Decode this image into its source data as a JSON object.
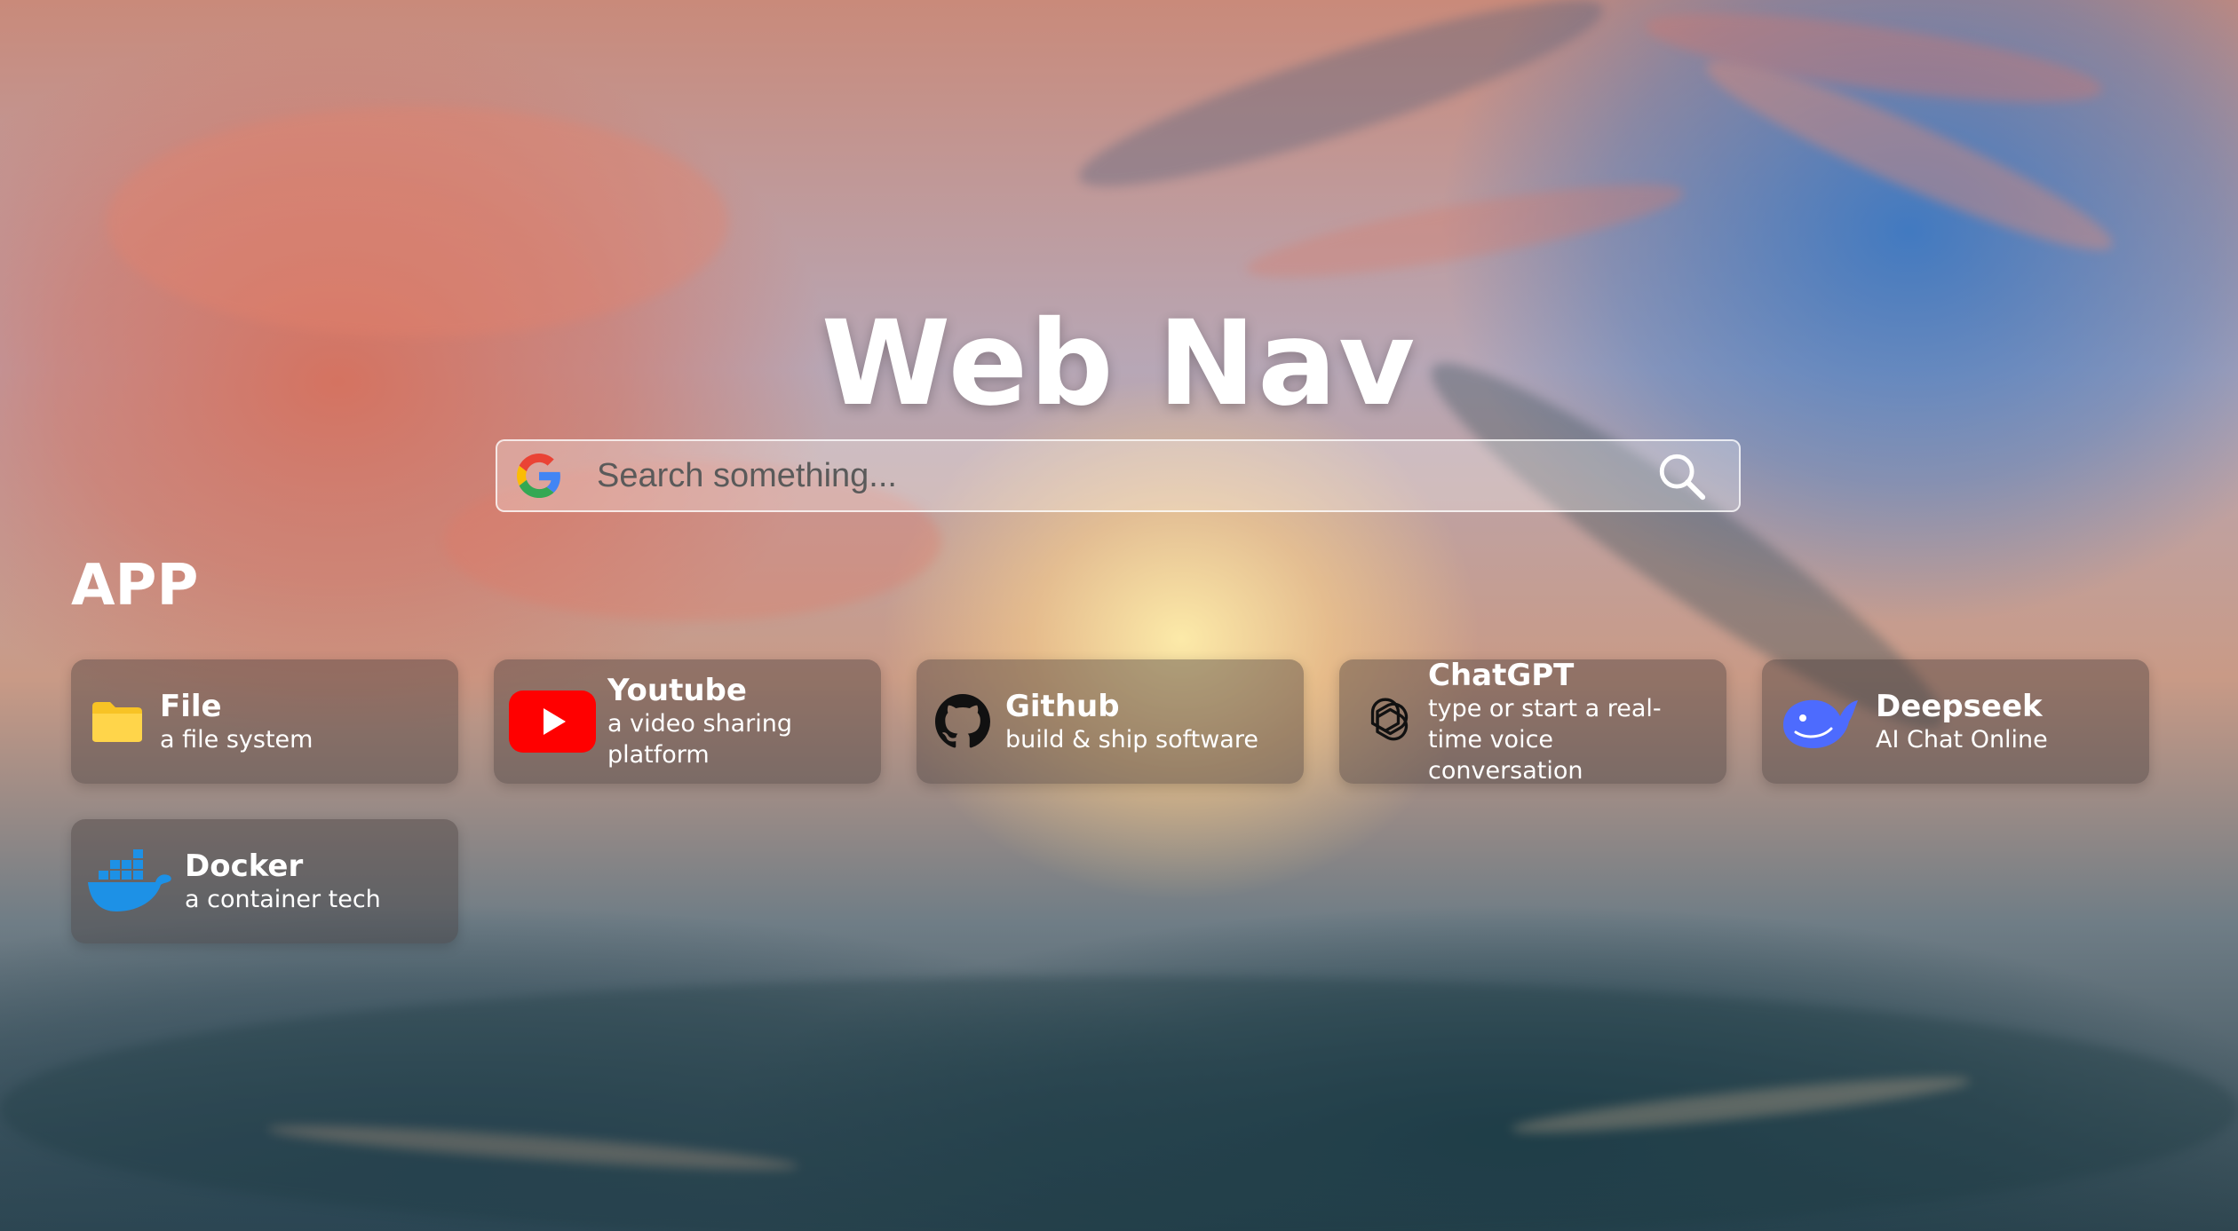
{
  "header": {
    "title": "Web Nav"
  },
  "search": {
    "placeholder": "Search something..."
  },
  "section": {
    "title": "APP"
  },
  "apps": [
    {
      "name": "File",
      "desc": "a file system",
      "icon": "folder-icon"
    },
    {
      "name": "Youtube",
      "desc": "a video sharing platform",
      "icon": "youtube-icon"
    },
    {
      "name": "Github",
      "desc": "build & ship software",
      "icon": "github-icon"
    },
    {
      "name": "ChatGPT",
      "desc": "type or start a real-time voice conversation",
      "icon": "chatgpt-icon"
    },
    {
      "name": "Deepseek",
      "desc": "AI Chat Online",
      "icon": "deepseek-icon"
    },
    {
      "name": "Docker",
      "desc": "a container tech",
      "icon": "docker-icon"
    }
  ],
  "colors": {
    "folder": "#f7c325",
    "youtube": "#ff0000",
    "deepseek": "#4d6bfe",
    "docker": "#1d91e6"
  }
}
